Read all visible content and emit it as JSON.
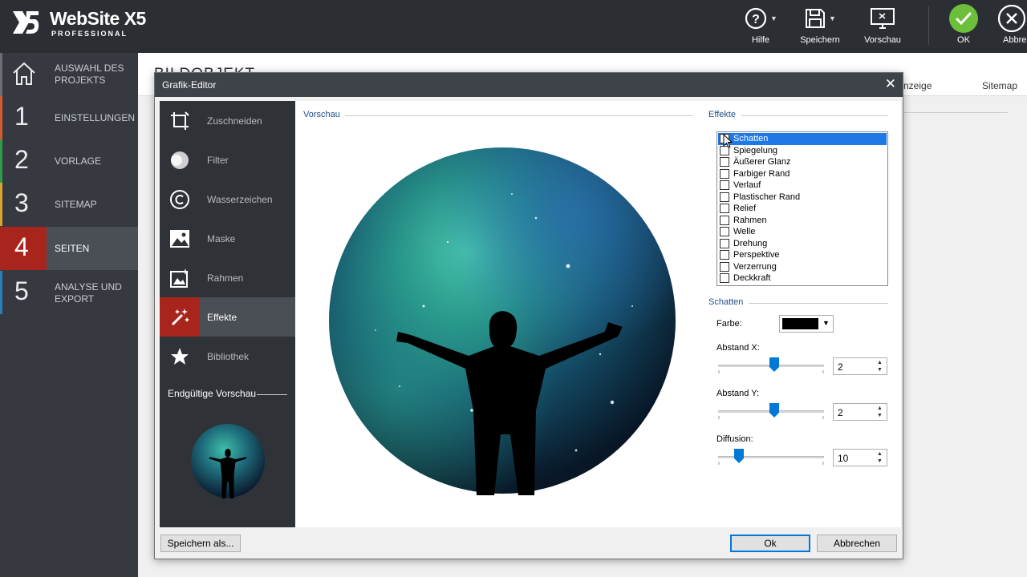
{
  "app": {
    "title": "WebSite X5",
    "subtitle": "PROFESSIONAL"
  },
  "toolbar": {
    "help": "Hilfe",
    "save": "Speichern",
    "preview": "Vorschau",
    "ok": "OK",
    "cancel": "Abbre"
  },
  "nav": {
    "items": [
      {
        "num": "",
        "label1": "AUSWAHL DES",
        "label2": "PROJEKTS",
        "color": "#6b6f75"
      },
      {
        "num": "1",
        "label1": "EINSTELLUNGEN",
        "label2": "",
        "color": "#d35c2c"
      },
      {
        "num": "2",
        "label1": "VORLAGE",
        "label2": "",
        "color": "#2e9b4a"
      },
      {
        "num": "3",
        "label1": "SITEMAP",
        "label2": "",
        "color": "#d7a62a"
      },
      {
        "num": "4",
        "label1": "SEITEN",
        "label2": "",
        "color": "#a8251e"
      },
      {
        "num": "5",
        "label1": "ANALYSE UND",
        "label2": "EXPORT",
        "color": "#2a7fb8"
      }
    ]
  },
  "background_page": {
    "title": "BILDOBJEKT",
    "tab_display": "nzeige",
    "tab_sitemap": "Sitemap"
  },
  "dialog": {
    "title": "Grafik-Editor",
    "tools": [
      {
        "label": "Zuschneiden",
        "icon": "crop-icon"
      },
      {
        "label": "Filter",
        "icon": "filter-icon"
      },
      {
        "label": "Wasserzeichen",
        "icon": "copyright-icon"
      },
      {
        "label": "Maske",
        "icon": "image-mask-icon"
      },
      {
        "label": "Rahmen",
        "icon": "frame-icon"
      },
      {
        "label": "Effekte",
        "icon": "magic-wand-icon"
      },
      {
        "label": "Bibliothek",
        "icon": "star-icon"
      }
    ],
    "final_preview_label": "Endgültige Vorschau",
    "preview_label": "Vorschau",
    "effects_label": "Effekte",
    "effects": [
      "Schatten",
      "Spiegelung",
      "Äußerer Glanz",
      "Farbiger Rand",
      "Verlauf",
      "Plastischer Rand",
      "Relief",
      "Rahmen",
      "Welle",
      "Drehung",
      "Perspektive",
      "Verzerrung",
      "Deckkraft"
    ],
    "shadow_section": "Schatten",
    "color_label": "Farbe:",
    "color_value": "#000000",
    "offset_x_label": "Abstand X:",
    "offset_x_value": "2",
    "offset_y_label": "Abstand Y:",
    "offset_y_value": "2",
    "diffusion_label": "Diffusion:",
    "diffusion_value": "10",
    "save_as": "Speichern als...",
    "ok": "Ok",
    "cancel": "Abbrechen"
  },
  "colors": {
    "accent_red": "#a8251e",
    "selection_blue": "#1e78e6",
    "ok_green": "#6cbf3a"
  }
}
